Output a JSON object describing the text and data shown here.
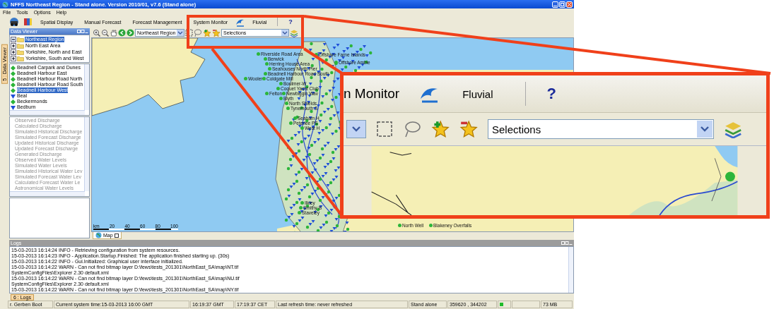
{
  "window": {
    "title": "NFFS Northeast Region - Stand alone. Version 2010/01, v7.6  (Stand alone)"
  },
  "menu": [
    "File",
    "Tools",
    "Options",
    "Help"
  ],
  "toolbar": {
    "buttons": [
      "Spatial Display",
      "Manual Forecast",
      "Forecast Management",
      "System Monitor",
      "Fluvial"
    ],
    "help": "?"
  },
  "data_viewer": {
    "side_tab": "5 : Data Viewer",
    "title": "Data Viewer",
    "tree": [
      {
        "label": "Northeast Region",
        "selected": true,
        "expanded": true,
        "children": [
          {
            "label": "North East Area",
            "selected": false
          },
          {
            "label": "Yorkshire, North and East",
            "selected": false
          },
          {
            "label": "Yorkshire, South and West",
            "selected": false
          }
        ]
      }
    ],
    "locations": [
      {
        "label": "Beadnell Carpark and Dunes",
        "kind": "gauge",
        "selected": false
      },
      {
        "label": "Beadnell Harbour East",
        "kind": "gauge",
        "selected": false
      },
      {
        "label": "Beadnell Harbour Road North",
        "kind": "gauge",
        "selected": false
      },
      {
        "label": "Beadnell Harbour Road South",
        "kind": "gauge",
        "selected": false
      },
      {
        "label": "Beadnell Harbour West",
        "kind": "gauge",
        "selected": true
      },
      {
        "label": "Beal",
        "kind": "river",
        "selected": false
      },
      {
        "label": "Beckermonds",
        "kind": "gauge",
        "selected": false
      },
      {
        "label": "Bedburn",
        "kind": "river",
        "selected": false
      }
    ],
    "parameters": [
      {
        "label": "Observed Discharge",
        "disabled": true
      },
      {
        "label": "Calculated Discharge",
        "disabled": true
      },
      {
        "label": "Simulated Historical Discharge",
        "disabled": true
      },
      {
        "label": "Simulated Forecast Discharge",
        "disabled": true
      },
      {
        "label": "Updated Historical Discharge",
        "disabled": true
      },
      {
        "label": "Updated Forecast Discharge",
        "disabled": true
      },
      {
        "label": "Generated Discharge",
        "disabled": true
      },
      {
        "label": "Observed Water Levels",
        "disabled": true
      },
      {
        "label": "Simulated Water Levels",
        "disabled": true
      },
      {
        "label": "Simulated Historical Water Lev",
        "disabled": true
      },
      {
        "label": "Simulated Forecast Water Lev",
        "disabled": true
      },
      {
        "label": "Calculated Forecast Water Le",
        "disabled": true
      },
      {
        "label": "Astronomical Water Levels",
        "disabled": true
      }
    ]
  },
  "map": {
    "region": "Northeast Region",
    "selections": "Selections",
    "labels": [
      "Riverside Road Area",
      "Berwick",
      "Offshore Farne Islands",
      "Herring House Area",
      "Seahouses North Pier",
      "Beadnell Harbour Road South",
      "Wooler",
      "Offshore Amble",
      "Coldgate Mill",
      "Boulmer-W",
      "Coquet Yacht Club",
      "Felton",
      "Newbiggin Wav",
      "Blyth",
      "North Shields",
      "Tynemouth S",
      "Seaham H",
      "Peterlee PS",
      "West H",
      "Ilkley",
      "Smithy B",
      "Staveley",
      "North Well",
      "Blakeney Overfalls"
    ],
    "scale": [
      "km",
      "20",
      "40",
      "60",
      "80",
      "100"
    ],
    "tab": "Map"
  },
  "logs": {
    "title": "Logs",
    "lines": [
      "15-03-2013 16:14:24 INFO - Retrieving configuration from system resources.",
      "15-03-2013 16:14:23 INFO - Application.Startup.Finished: The application finished starting up. (30s)",
      "15-03-2013 16:14:22 INFO - Gui.Initialized: Graphical user interface initialized.",
      "15-03-2013 16:14:22 WARN - Can not find bitmap layer  D:\\fews\\tests_201301\\NorthEast_SA\\map\\NT.tif",
      "SystemConfigFiles\\Explorer 2.30 default.xml",
      "15-03-2013 16:14:22 WARN - Can not find bitmap layer  D:\\fews\\tests_201301\\NorthEast_SA\\map\\NU.tif",
      "SystemConfigFiles\\Explorer 2.30 default.xml",
      "15-03-2013 16:14:22 WARN - Can not find bitmap layer  D:\\fews\\tests_201301\\NorthEast_SA\\map\\NY.tif"
    ],
    "tab": "6 : Logs"
  },
  "status_bar": {
    "user": "r. Gerben Boot",
    "system_time": "Current system time:15-03-2013 16:00 GMT",
    "gmt": "16:19:37 GMT",
    "cet": "17:19:37 CET",
    "refresh": "Last refresh time: never refreshed",
    "mode": "Stand alone",
    "coordinates": "359620 , 344202",
    "connected": true,
    "memory": "73 MB"
  },
  "callout": {
    "monitor": "n Monitor",
    "fluvial": "Fluvial",
    "help": "?",
    "selections": "Selections"
  }
}
